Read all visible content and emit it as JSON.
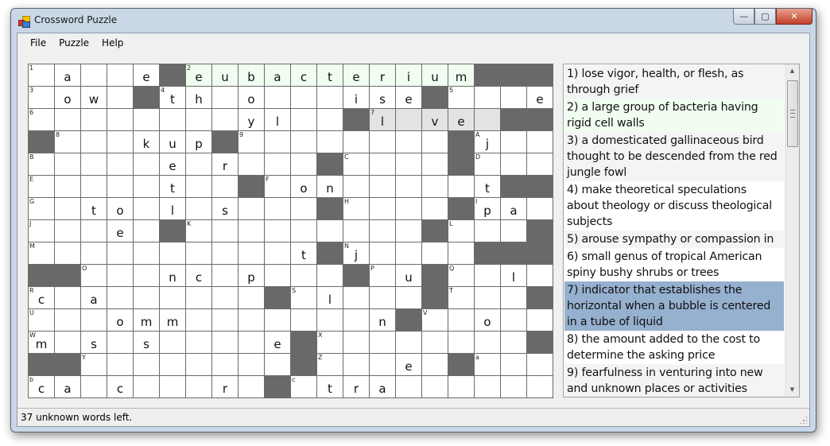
{
  "window": {
    "title": "Crossword Puzzle",
    "controls": {
      "minimize": "—",
      "maximize": "▢",
      "close": "✕"
    }
  },
  "menu": [
    {
      "label": "File"
    },
    {
      "label": "Puzzle"
    },
    {
      "label": "Help"
    }
  ],
  "colors": {
    "black_cell": "#696969",
    "solved_word": "#f0fdf0",
    "active_word": "#e3e3e3",
    "selected_clue": "#96b0cf"
  },
  "grid": {
    "columns": 20,
    "rows": [
      [
        {
          "n": "1",
          "l": ""
        },
        {
          "l": "a"
        },
        {
          "l": ""
        },
        {
          "l": ""
        },
        {
          "l": "e"
        },
        "#",
        {
          "n": "2",
          "l": "e",
          "s": "solved"
        },
        {
          "l": "u",
          "s": "solved"
        },
        {
          "l": "b",
          "s": "solved"
        },
        {
          "l": "a",
          "s": "solved"
        },
        {
          "l": "c",
          "s": "solved"
        },
        {
          "l": "t",
          "s": "solved"
        },
        {
          "l": "e",
          "s": "solved"
        },
        {
          "l": "r",
          "s": "solved"
        },
        {
          "l": "i",
          "s": "solved"
        },
        {
          "l": "u",
          "s": "solved"
        },
        {
          "l": "m",
          "s": "solved"
        },
        "#",
        "#",
        "#"
      ],
      [
        {
          "n": "3",
          "l": ""
        },
        {
          "l": "o"
        },
        {
          "l": "w"
        },
        {
          "l": ""
        },
        "#",
        {
          "n": "4",
          "l": "t"
        },
        {
          "l": "h"
        },
        {
          "l": ""
        },
        {
          "l": "o"
        },
        {
          "l": ""
        },
        {
          "l": ""
        },
        {
          "l": ""
        },
        {
          "l": "i"
        },
        {
          "l": "s"
        },
        {
          "l": "e"
        },
        "#",
        {
          "n": "5",
          "l": ""
        },
        {
          "l": ""
        },
        {
          "l": ""
        },
        {
          "l": "e"
        }
      ],
      [
        {
          "n": "6",
          "l": ""
        },
        {
          "l": ""
        },
        {
          "l": ""
        },
        {
          "l": ""
        },
        {
          "l": ""
        },
        {
          "l": ""
        },
        {
          "l": ""
        },
        {
          "l": ""
        },
        {
          "l": "y"
        },
        {
          "l": "l"
        },
        {
          "l": ""
        },
        {
          "l": ""
        },
        "#",
        {
          "n": "7",
          "l": "l",
          "s": "active"
        },
        {
          "l": "",
          "s": "active"
        },
        {
          "l": "v",
          "s": "active"
        },
        {
          "l": "e",
          "s": "active"
        },
        {
          "l": "",
          "s": "active"
        },
        "#",
        "#"
      ],
      [
        "#",
        {
          "n": "8",
          "l": ""
        },
        {
          "l": ""
        },
        {
          "l": ""
        },
        {
          "l": "k"
        },
        {
          "l": "u"
        },
        {
          "l": "p"
        },
        "#",
        {
          "n": "9",
          "l": ""
        },
        {
          "l": ""
        },
        {
          "l": ""
        },
        {
          "l": ""
        },
        {
          "l": ""
        },
        {
          "l": ""
        },
        {
          "l": ""
        },
        {
          "l": ""
        },
        "#",
        {
          "n": "A",
          "l": "j"
        },
        {
          "l": ""
        },
        {
          "l": ""
        }
      ],
      [
        {
          "n": "B",
          "l": ""
        },
        {
          "l": ""
        },
        {
          "l": ""
        },
        {
          "l": ""
        },
        {
          "l": ""
        },
        {
          "l": "e"
        },
        {
          "l": ""
        },
        {
          "l": "r"
        },
        {
          "l": ""
        },
        {
          "l": ""
        },
        {
          "l": ""
        },
        "#",
        {
          "n": "C",
          "l": ""
        },
        {
          "l": ""
        },
        {
          "l": ""
        },
        {
          "l": ""
        },
        "#",
        {
          "n": "D",
          "l": ""
        },
        {
          "l": ""
        },
        {
          "l": ""
        }
      ],
      [
        {
          "n": "E",
          "l": ""
        },
        {
          "l": ""
        },
        {
          "l": ""
        },
        {
          "l": ""
        },
        {
          "l": ""
        },
        {
          "l": "t"
        },
        {
          "l": ""
        },
        {
          "l": ""
        },
        "#",
        {
          "n": "F",
          "l": ""
        },
        {
          "l": "o"
        },
        {
          "l": "n"
        },
        {
          "l": ""
        },
        {
          "l": ""
        },
        {
          "l": ""
        },
        {
          "l": ""
        },
        {
          "l": ""
        },
        {
          "l": "t"
        },
        "#",
        "#"
      ],
      [
        {
          "n": "G",
          "l": ""
        },
        {
          "l": ""
        },
        {
          "l": "t"
        },
        {
          "l": "o"
        },
        {
          "l": ""
        },
        {
          "l": "l"
        },
        {
          "l": ""
        },
        {
          "l": "s"
        },
        {
          "l": ""
        },
        {
          "l": ""
        },
        {
          "l": ""
        },
        "#",
        {
          "n": "H",
          "l": ""
        },
        {
          "l": ""
        },
        {
          "l": ""
        },
        {
          "l": ""
        },
        "#",
        {
          "n": "I",
          "l": "p"
        },
        {
          "l": "a"
        },
        {
          "l": ""
        }
      ],
      [
        {
          "n": "J",
          "l": ""
        },
        {
          "l": ""
        },
        {
          "l": ""
        },
        {
          "l": "e"
        },
        {
          "l": ""
        },
        "#",
        {
          "n": "K",
          "l": ""
        },
        {
          "l": ""
        },
        {
          "l": ""
        },
        {
          "l": ""
        },
        {
          "l": ""
        },
        {
          "l": ""
        },
        {
          "l": ""
        },
        {
          "l": ""
        },
        {
          "l": ""
        },
        "#",
        {
          "n": "L",
          "l": ""
        },
        {
          "l": ""
        },
        {
          "l": ""
        },
        "#"
      ],
      [
        {
          "n": "M",
          "l": ""
        },
        {
          "l": ""
        },
        {
          "l": ""
        },
        {
          "l": ""
        },
        {
          "l": ""
        },
        {
          "l": ""
        },
        {
          "l": ""
        },
        {
          "l": ""
        },
        {
          "l": ""
        },
        {
          "l": ""
        },
        {
          "l": "t"
        },
        "#",
        {
          "n": "N",
          "l": "j"
        },
        {
          "l": ""
        },
        {
          "l": ""
        },
        {
          "l": ""
        },
        {
          "l": ""
        },
        "#",
        "#",
        "#"
      ],
      [
        "#",
        "#",
        {
          "n": "O",
          "l": ""
        },
        {
          "l": ""
        },
        {
          "l": ""
        },
        {
          "l": "n"
        },
        {
          "l": "c"
        },
        {
          "l": ""
        },
        {
          "l": "p"
        },
        {
          "l": ""
        },
        {
          "l": ""
        },
        {
          "l": ""
        },
        "#",
        {
          "n": "P",
          "l": ""
        },
        {
          "l": "u"
        },
        "#",
        {
          "n": "Q",
          "l": ""
        },
        {
          "l": ""
        },
        {
          "l": "l"
        },
        {
          "l": ""
        }
      ],
      [
        {
          "n": "R",
          "l": "c"
        },
        {
          "l": ""
        },
        {
          "l": "a"
        },
        {
          "l": ""
        },
        {
          "l": ""
        },
        {
          "l": ""
        },
        {
          "l": ""
        },
        {
          "l": ""
        },
        {
          "l": ""
        },
        "#",
        {
          "n": "S",
          "l": ""
        },
        {
          "l": "l"
        },
        {
          "l": ""
        },
        {
          "l": ""
        },
        {
          "l": ""
        },
        "#",
        {
          "n": "T",
          "l": ""
        },
        {
          "l": ""
        },
        {
          "l": ""
        },
        "#"
      ],
      [
        {
          "n": "U",
          "l": ""
        },
        {
          "l": ""
        },
        {
          "l": ""
        },
        {
          "l": "o"
        },
        {
          "l": "m"
        },
        {
          "l": "m"
        },
        {
          "l": ""
        },
        {
          "l": ""
        },
        {
          "l": ""
        },
        {
          "l": ""
        },
        {
          "l": ""
        },
        {
          "l": ""
        },
        {
          "l": ""
        },
        {
          "l": "n"
        },
        "#",
        {
          "n": "V",
          "l": ""
        },
        {
          "l": ""
        },
        {
          "l": "o"
        },
        {
          "l": ""
        },
        {
          "l": ""
        }
      ],
      [
        {
          "n": "W",
          "l": "m"
        },
        {
          "l": ""
        },
        {
          "l": "s"
        },
        {
          "l": ""
        },
        {
          "l": "s"
        },
        {
          "l": ""
        },
        {
          "l": ""
        },
        {
          "l": ""
        },
        {
          "l": ""
        },
        {
          "l": "e"
        },
        "#",
        {
          "n": "X",
          "l": ""
        },
        {
          "l": ""
        },
        {
          "l": ""
        },
        {
          "l": ""
        },
        {
          "l": ""
        },
        {
          "l": ""
        },
        {
          "l": ""
        },
        {
          "l": ""
        },
        "#"
      ],
      [
        "#",
        "#",
        {
          "n": "Y",
          "l": ""
        },
        {
          "l": ""
        },
        {
          "l": ""
        },
        {
          "l": ""
        },
        {
          "l": ""
        },
        {
          "l": ""
        },
        {
          "l": ""
        },
        {
          "l": ""
        },
        "#",
        {
          "n": "Z",
          "l": ""
        },
        {
          "l": ""
        },
        {
          "l": ""
        },
        {
          "l": "e"
        },
        {
          "l": ""
        },
        "#",
        {
          "n": "a",
          "l": ""
        },
        {
          "l": ""
        },
        {
          "l": ""
        }
      ],
      [
        {
          "n": "b",
          "l": "c"
        },
        {
          "l": "a"
        },
        {
          "l": ""
        },
        {
          "l": "c"
        },
        {
          "l": ""
        },
        {
          "l": ""
        },
        {
          "l": ""
        },
        {
          "l": "r"
        },
        {
          "l": ""
        },
        "#",
        {
          "n": "c",
          "l": ""
        },
        {
          "l": "t"
        },
        {
          "l": "r"
        },
        {
          "l": "a"
        },
        {
          "l": ""
        },
        {
          "l": ""
        },
        {
          "l": ""
        },
        {
          "l": ""
        },
        {
          "l": ""
        },
        {
          "l": ""
        }
      ]
    ]
  },
  "clues": [
    {
      "text": "1) lose vigor, health, or flesh, as through grief",
      "state": "grey"
    },
    {
      "text": "2) a large group of bacteria having rigid cell walls",
      "state": "green"
    },
    {
      "text": "3) a domesticated gallinaceous bird thought to be descended from the red jungle fowl",
      "state": "grey"
    },
    {
      "text": "4) make theoretical speculations about theology or discuss theological subjects",
      "state": "white"
    },
    {
      "text": "5) arouse sympathy or compassion in",
      "state": "grey"
    },
    {
      "text": "6) small genus of tropical American spiny bushy shrubs or trees",
      "state": "white"
    },
    {
      "text": "7) indicator that establishes the horizontal when a bubble is centered in a tube of liquid",
      "state": "selected"
    },
    {
      "text": "8) the amount added to the cost to determine the asking price",
      "state": "white"
    },
    {
      "text": "9) fearfulness in venturing into new and unknown places or activities",
      "state": "grey"
    }
  ],
  "scrollbar": {
    "up_icon": "▲",
    "down_icon": "▼"
  },
  "status": {
    "text": "37 unknown words left."
  }
}
